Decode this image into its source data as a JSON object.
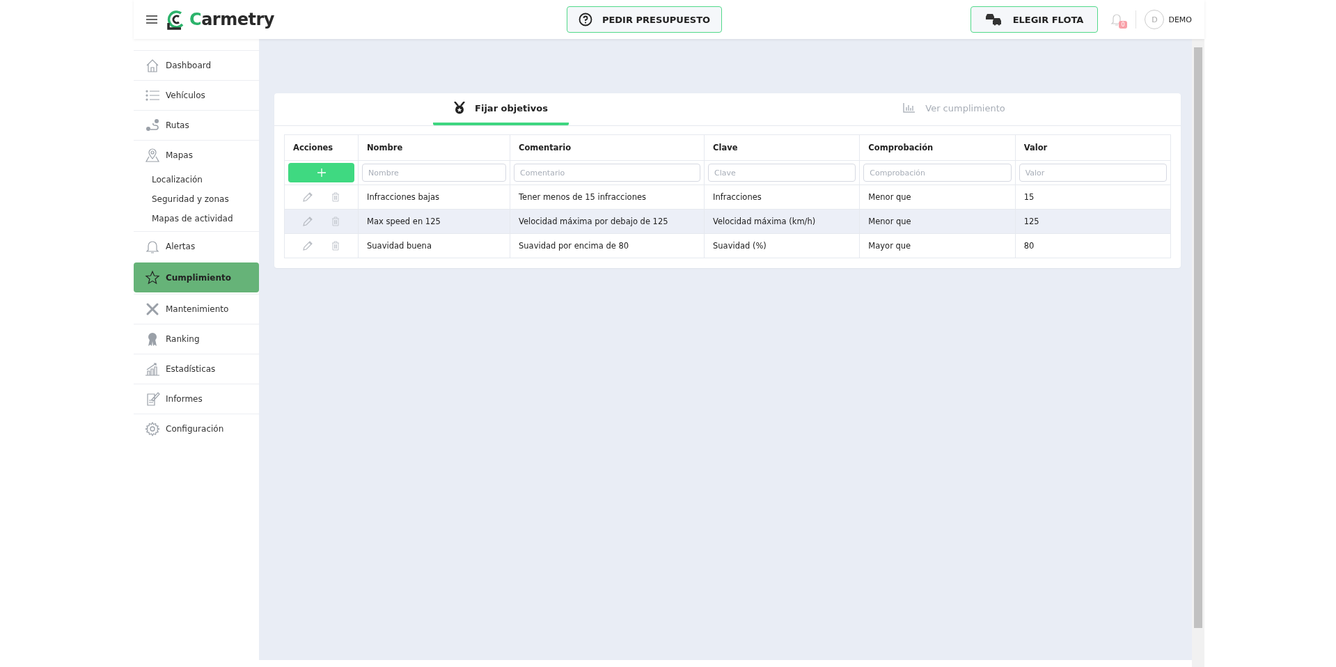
{
  "header": {
    "logo": "Carmetry",
    "quote_button": "PEDIR PRESUPUESTO",
    "fleet_button": "ELEGIR FLOTA",
    "notifications": "0",
    "avatar": "D",
    "user": "DEMO"
  },
  "sidebar": {
    "items": [
      {
        "label": "Dashboard",
        "selected": false
      },
      {
        "label": "Vehículos",
        "selected": false
      },
      {
        "label": "Rutas",
        "selected": false
      },
      {
        "label": "Mapas",
        "selected": false,
        "children": [
          {
            "label": "Localización"
          },
          {
            "label": "Seguridad y zonas"
          },
          {
            "label": "Mapas de actividad"
          }
        ]
      },
      {
        "label": "Alertas",
        "selected": false
      },
      {
        "label": "Cumplimiento",
        "selected": true
      },
      {
        "label": "Mantenimiento",
        "selected": false
      },
      {
        "label": "Ranking",
        "selected": false
      },
      {
        "label": "Estadísticas",
        "selected": false
      },
      {
        "label": "Informes",
        "selected": false
      },
      {
        "label": "Configuración",
        "selected": false
      }
    ]
  },
  "tabs": [
    {
      "label": "Fijar objetivos",
      "selected": true
    },
    {
      "label": "Ver cumplimiento",
      "selected": false
    }
  ],
  "table": {
    "columns": [
      "Acciones",
      "Nombre",
      "Comentario",
      "Clave",
      "Comprobación",
      "Valor"
    ],
    "filters": [
      {
        "placeholder": "Nombre"
      },
      {
        "placeholder": "Comentario"
      },
      {
        "placeholder": "Clave"
      },
      {
        "placeholder": "Comprobación"
      },
      {
        "placeholder": "Valor"
      }
    ],
    "rows": [
      {
        "cells": [
          "",
          "Infracciones bajas",
          "Tener menos de 15 infracciones",
          "Infracciones",
          "Menor que",
          "15"
        ],
        "highlighted": false
      },
      {
        "cells": [
          "",
          "Max speed en 125",
          "Velocidad máxima por debajo de 125",
          "Velocidad máxima (km/h)",
          "Menor que",
          "125"
        ],
        "highlighted": true
      },
      {
        "cells": [
          "",
          "Suavidad buena",
          "Suavidad por encima de 80",
          "Suavidad (%)",
          "Mayor que",
          "80"
        ],
        "highlighted": false
      }
    ]
  }
}
